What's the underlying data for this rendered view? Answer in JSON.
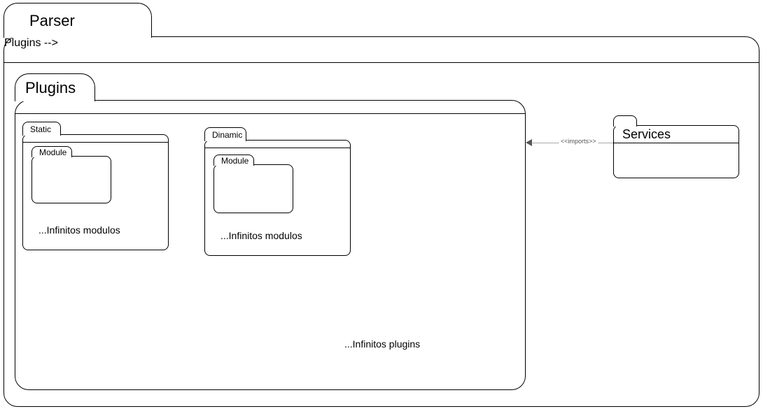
{
  "parser": {
    "label": "Parser",
    "plugins": {
      "label": "Plugins",
      "static": {
        "label": "Static",
        "module": {
          "label": "Module"
        },
        "note": "...Infinitos modulos"
      },
      "dinamic": {
        "label": "Dinamic",
        "module": {
          "label": "Module"
        },
        "note": "...Infinitos modulos"
      },
      "note": "...Infinitos plugins"
    },
    "services": {
      "label": "Services"
    },
    "dependency": {
      "label": "<<imports>>"
    }
  }
}
